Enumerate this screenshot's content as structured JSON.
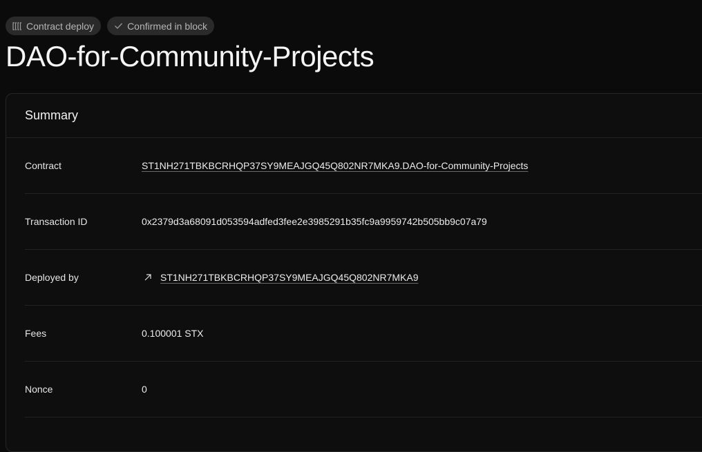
{
  "badges": [
    {
      "icon": "code-brackets-icon",
      "label": "Contract deploy"
    },
    {
      "icon": "check-icon",
      "label": "Confirmed in block"
    }
  ],
  "title": "DAO-for-Community-Projects",
  "summary": {
    "heading": "Summary",
    "rows": [
      {
        "label": "Contract",
        "value": "ST1NH271TBKBCRHQP37SY9MEAJGQ45Q802NR7MKA9.DAO-for-Community-Projects"
      },
      {
        "label": "Transaction ID",
        "value": "0x2379d3a68091d053594adfed3fee2e3985291b35fc9a9959742b505bb9c07a79"
      },
      {
        "label": "Deployed by",
        "value": "ST1NH271TBKBCRHQP37SY9MEAJGQ45Q802NR7MKA9",
        "icon": "arrow-up-right-icon"
      },
      {
        "label": "Fees",
        "value": "0.100001 STX"
      },
      {
        "label": "Nonce",
        "value": "0"
      }
    ]
  },
  "colors": {
    "background": "#0b0b0b",
    "badge_bg": "#2a2a2a",
    "text": "#f2f2f2",
    "divider": "#232323"
  }
}
